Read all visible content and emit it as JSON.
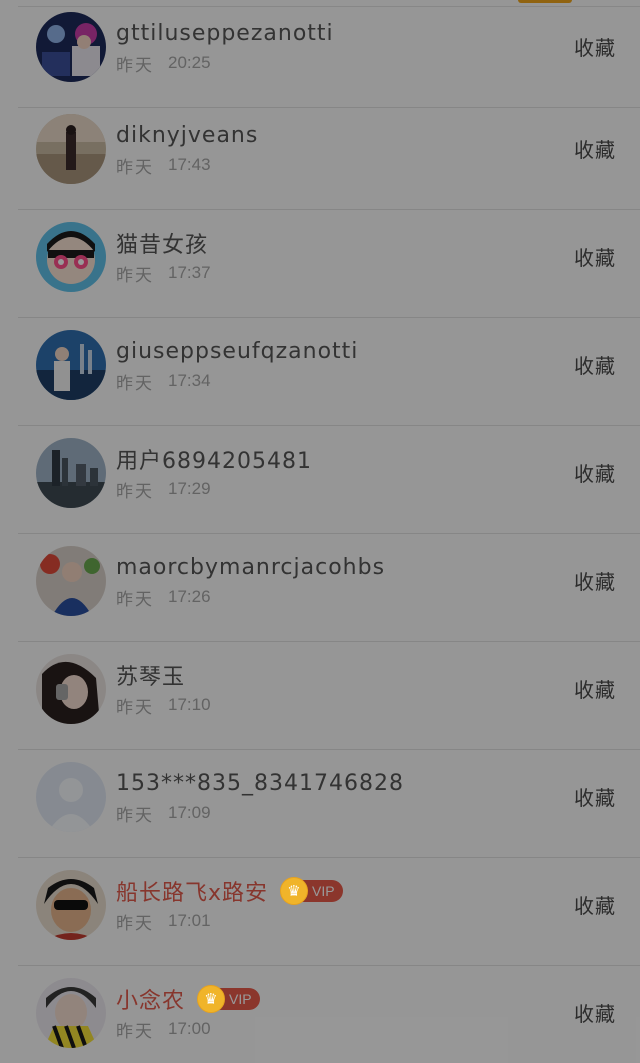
{
  "rows": [
    {
      "name": "gttiluseppezanotti",
      "day": "昨天",
      "time": "20:25",
      "action": "收藏",
      "vip": false
    },
    {
      "name": "diknyjveans",
      "day": "昨天",
      "time": "17:43",
      "action": "收藏",
      "vip": false
    },
    {
      "name": "猫昔女孩",
      "day": "昨天",
      "time": "17:37",
      "action": "收藏",
      "vip": false
    },
    {
      "name": "giuseppseufqzanotti",
      "day": "昨天",
      "time": "17:34",
      "action": "收藏",
      "vip": false
    },
    {
      "name": "用户6894205481",
      "day": "昨天",
      "time": "17:29",
      "action": "收藏",
      "vip": false
    },
    {
      "name": "maorcbymanrcjacohbs",
      "day": "昨天",
      "time": "17:26",
      "action": "收藏",
      "vip": false
    },
    {
      "name": "苏琴玉",
      "day": "昨天",
      "time": "17:10",
      "action": "收藏",
      "vip": false
    },
    {
      "name": "153***835_8341746828",
      "day": "昨天",
      "time": "17:09",
      "action": "收藏",
      "vip": false
    },
    {
      "name": "船长路飞x路安",
      "day": "昨天",
      "time": "17:01",
      "action": "收藏",
      "vip": true,
      "vip_label": "VIP"
    },
    {
      "name": "小念农",
      "day": "昨天",
      "time": "17:00",
      "action": "收藏",
      "vip": true,
      "vip_label": "VIP"
    }
  ],
  "colors": {
    "vip_name": "#e25a4c",
    "vip_badge": "#e85a4a",
    "crown": "#f0b42a",
    "overlay": "rgba(0,0,0,0.40)"
  }
}
